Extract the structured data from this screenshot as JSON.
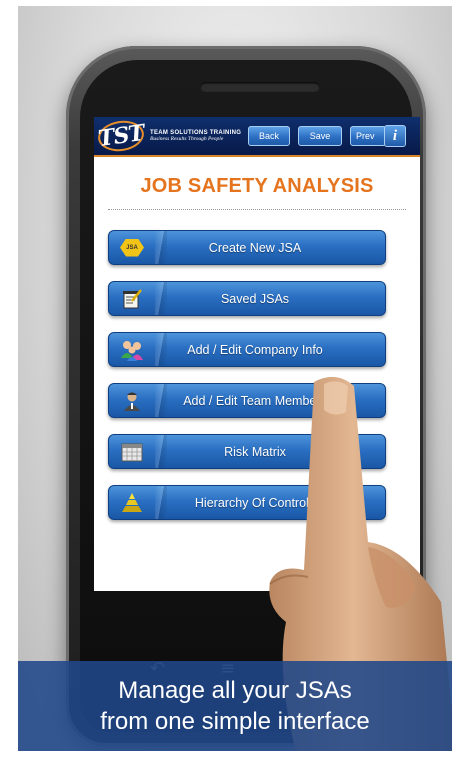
{
  "app": {
    "logo_text": "TST",
    "brand_name": "TEAM SOLUTIONS TRAINING",
    "brand_tagline": "Business Results Through People"
  },
  "toolbar": {
    "back_label": "Back",
    "save_label": "Save",
    "prev_label": "Prev",
    "info_label": "i"
  },
  "page": {
    "title": "JOB SAFETY ANALYSIS"
  },
  "menu": {
    "items": [
      {
        "label": "Create New JSA",
        "icon": "jsa-hexagon-icon",
        "icon_text": "JSA"
      },
      {
        "label": "Saved JSAs",
        "icon": "notepad-pencil-icon"
      },
      {
        "label": "Add / Edit Company Info",
        "icon": "people-group-icon"
      },
      {
        "label": "Add / Edit Team Members",
        "icon": "team-member-icon"
      },
      {
        "label": "Risk Matrix",
        "icon": "calendar-grid-icon"
      },
      {
        "label": "Hierarchy Of Controls",
        "icon": "pyramid-icon"
      }
    ]
  },
  "caption": {
    "line1": "Manage all your JSAs",
    "line2": "from one simple interface"
  },
  "colors": {
    "topbar": "#0a2257",
    "accent_orange": "#e5741f",
    "button_blue": "#2a6fc2",
    "caption_bg": "#20488a"
  }
}
